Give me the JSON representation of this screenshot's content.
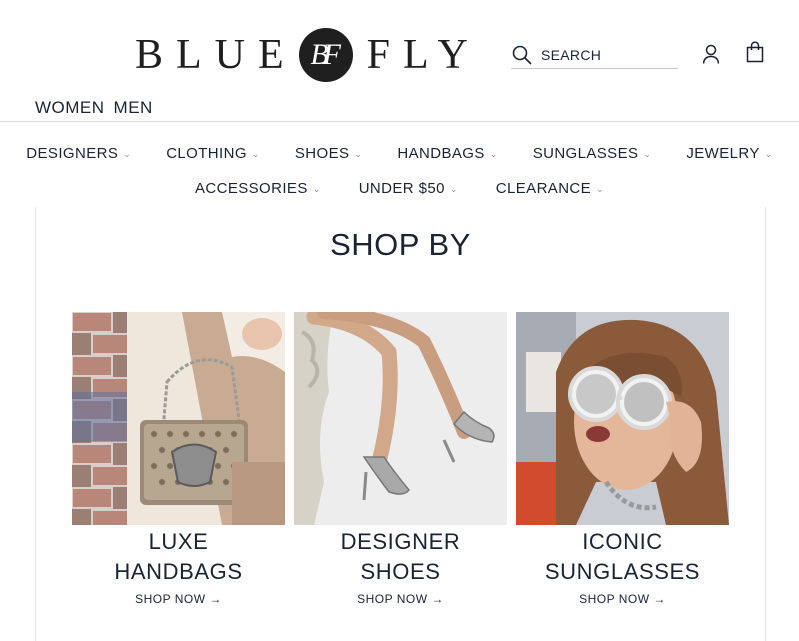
{
  "brand": {
    "word_left": "BLUE",
    "badge": "BF",
    "word_right": "FLY"
  },
  "search": {
    "placeholder": "SEARCH",
    "icon": "search-icon"
  },
  "header_icons": {
    "account": "account-icon",
    "cart": "shopping-bag-icon"
  },
  "gender_nav": [
    "WOMEN",
    "MEN"
  ],
  "main_nav": {
    "row1": [
      "DESIGNERS",
      "CLOTHING",
      "SHOES",
      "HANDBAGS",
      "SUNGLASSES",
      "JEWELRY"
    ],
    "row2": [
      "ACCESSORIES",
      "UNDER $50",
      "CLEARANCE"
    ],
    "chevron": "⌄"
  },
  "shop_by": {
    "title": "SHOP BY",
    "cards": [
      {
        "title": "LUXE\nHANDBAGS",
        "cta": "SHOP NOW →"
      },
      {
        "title": "DESIGNER\nSHOES",
        "cta": "SHOP NOW →"
      },
      {
        "title": "ICONIC\nSUNGLASSES",
        "cta": "SHOP NOW →"
      }
    ]
  },
  "colors": {
    "text": "#1a2433",
    "divider": "#d9d9d9",
    "logo": "#1f1f1f"
  }
}
